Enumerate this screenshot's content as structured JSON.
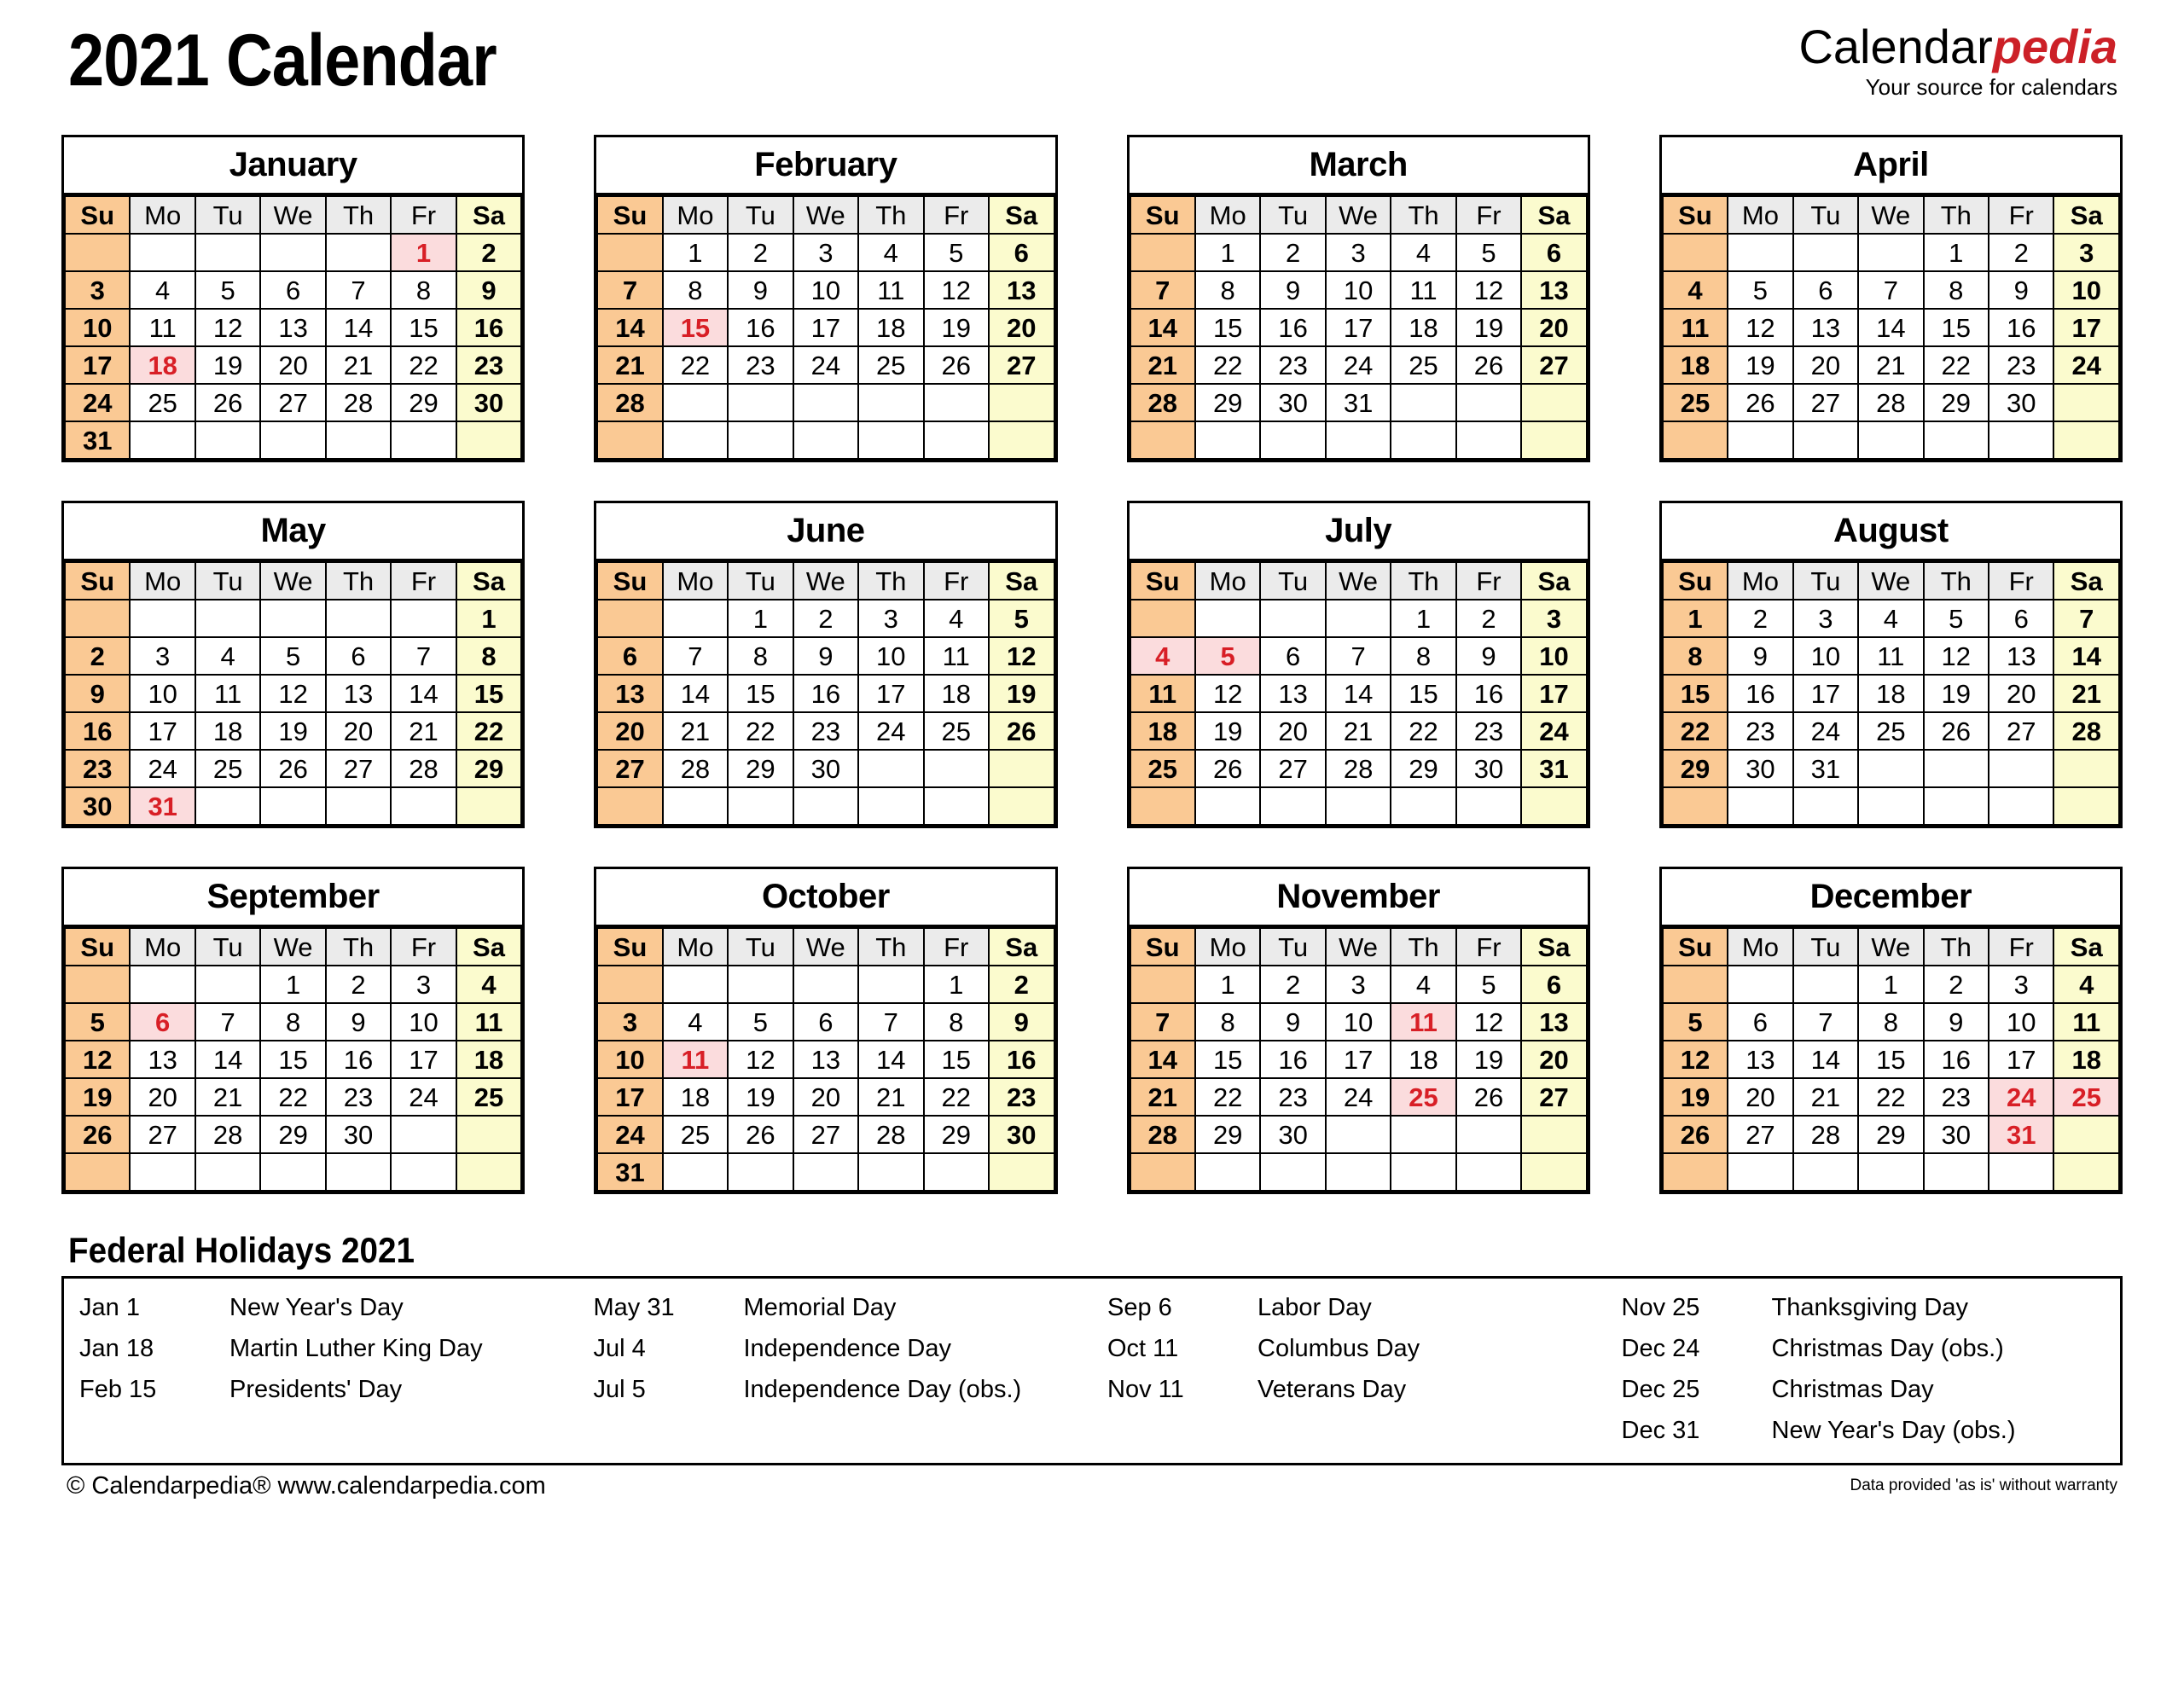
{
  "header": {
    "title": "2021 Calendar",
    "brand_word1": "Calendar",
    "brand_word2": "pedia",
    "brand_tagline": "Your source for calendars"
  },
  "colors": {
    "sunday_bg": "#FAC994",
    "saturday_bg": "#FBFBCE",
    "weekday_header_bg": "#EBEBEB",
    "holiday_bg": "#FBDCDD",
    "holiday_text": "#D81F26",
    "brand_accent": "#CC2027",
    "border": "#000000"
  },
  "weekday_headers": [
    "Su",
    "Mo",
    "Tu",
    "We",
    "Th",
    "Fr",
    "Sa"
  ],
  "months": [
    {
      "name": "January",
      "weeks": [
        [
          "",
          "",
          "",
          "",
          "",
          "1",
          "2"
        ],
        [
          "3",
          "4",
          "5",
          "6",
          "7",
          "8",
          "9"
        ],
        [
          "10",
          "11",
          "12",
          "13",
          "14",
          "15",
          "16"
        ],
        [
          "17",
          "18",
          "19",
          "20",
          "21",
          "22",
          "23"
        ],
        [
          "24",
          "25",
          "26",
          "27",
          "28",
          "29",
          "30"
        ],
        [
          "31",
          "",
          "",
          "",
          "",
          "",
          ""
        ]
      ],
      "holidays": [
        "1",
        "18"
      ]
    },
    {
      "name": "February",
      "weeks": [
        [
          "",
          "1",
          "2",
          "3",
          "4",
          "5",
          "6"
        ],
        [
          "7",
          "8",
          "9",
          "10",
          "11",
          "12",
          "13"
        ],
        [
          "14",
          "15",
          "16",
          "17",
          "18",
          "19",
          "20"
        ],
        [
          "21",
          "22",
          "23",
          "24",
          "25",
          "26",
          "27"
        ],
        [
          "28",
          "",
          "",
          "",
          "",
          "",
          ""
        ],
        [
          "",
          "",
          "",
          "",
          "",
          "",
          ""
        ]
      ],
      "holidays": [
        "15"
      ]
    },
    {
      "name": "March",
      "weeks": [
        [
          "",
          "1",
          "2",
          "3",
          "4",
          "5",
          "6"
        ],
        [
          "7",
          "8",
          "9",
          "10",
          "11",
          "12",
          "13"
        ],
        [
          "14",
          "15",
          "16",
          "17",
          "18",
          "19",
          "20"
        ],
        [
          "21",
          "22",
          "23",
          "24",
          "25",
          "26",
          "27"
        ],
        [
          "28",
          "29",
          "30",
          "31",
          "",
          "",
          ""
        ],
        [
          "",
          "",
          "",
          "",
          "",
          "",
          ""
        ]
      ],
      "holidays": []
    },
    {
      "name": "April",
      "weeks": [
        [
          "",
          "",
          "",
          "",
          "1",
          "2",
          "3"
        ],
        [
          "4",
          "5",
          "6",
          "7",
          "8",
          "9",
          "10"
        ],
        [
          "11",
          "12",
          "13",
          "14",
          "15",
          "16",
          "17"
        ],
        [
          "18",
          "19",
          "20",
          "21",
          "22",
          "23",
          "24"
        ],
        [
          "25",
          "26",
          "27",
          "28",
          "29",
          "30",
          ""
        ],
        [
          "",
          "",
          "",
          "",
          "",
          "",
          ""
        ]
      ],
      "holidays": []
    },
    {
      "name": "May",
      "weeks": [
        [
          "",
          "",
          "",
          "",
          "",
          "",
          "1"
        ],
        [
          "2",
          "3",
          "4",
          "5",
          "6",
          "7",
          "8"
        ],
        [
          "9",
          "10",
          "11",
          "12",
          "13",
          "14",
          "15"
        ],
        [
          "16",
          "17",
          "18",
          "19",
          "20",
          "21",
          "22"
        ],
        [
          "23",
          "24",
          "25",
          "26",
          "27",
          "28",
          "29"
        ],
        [
          "30",
          "31",
          "",
          "",
          "",
          "",
          ""
        ]
      ],
      "holidays": [
        "31"
      ]
    },
    {
      "name": "June",
      "weeks": [
        [
          "",
          "",
          "1",
          "2",
          "3",
          "4",
          "5"
        ],
        [
          "6",
          "7",
          "8",
          "9",
          "10",
          "11",
          "12"
        ],
        [
          "13",
          "14",
          "15",
          "16",
          "17",
          "18",
          "19"
        ],
        [
          "20",
          "21",
          "22",
          "23",
          "24",
          "25",
          "26"
        ],
        [
          "27",
          "28",
          "29",
          "30",
          "",
          "",
          ""
        ],
        [
          "",
          "",
          "",
          "",
          "",
          "",
          ""
        ]
      ],
      "holidays": []
    },
    {
      "name": "July",
      "weeks": [
        [
          "",
          "",
          "",
          "",
          "1",
          "2",
          "3"
        ],
        [
          "4",
          "5",
          "6",
          "7",
          "8",
          "9",
          "10"
        ],
        [
          "11",
          "12",
          "13",
          "14",
          "15",
          "16",
          "17"
        ],
        [
          "18",
          "19",
          "20",
          "21",
          "22",
          "23",
          "24"
        ],
        [
          "25",
          "26",
          "27",
          "28",
          "29",
          "30",
          "31"
        ],
        [
          "",
          "",
          "",
          "",
          "",
          "",
          ""
        ]
      ],
      "holidays": [
        "4",
        "5"
      ]
    },
    {
      "name": "August",
      "weeks": [
        [
          "1",
          "2",
          "3",
          "4",
          "5",
          "6",
          "7"
        ],
        [
          "8",
          "9",
          "10",
          "11",
          "12",
          "13",
          "14"
        ],
        [
          "15",
          "16",
          "17",
          "18",
          "19",
          "20",
          "21"
        ],
        [
          "22",
          "23",
          "24",
          "25",
          "26",
          "27",
          "28"
        ],
        [
          "29",
          "30",
          "31",
          "",
          "",
          "",
          ""
        ],
        [
          "",
          "",
          "",
          "",
          "",
          "",
          ""
        ]
      ],
      "holidays": []
    },
    {
      "name": "September",
      "weeks": [
        [
          "",
          "",
          "",
          "1",
          "2",
          "3",
          "4"
        ],
        [
          "5",
          "6",
          "7",
          "8",
          "9",
          "10",
          "11"
        ],
        [
          "12",
          "13",
          "14",
          "15",
          "16",
          "17",
          "18"
        ],
        [
          "19",
          "20",
          "21",
          "22",
          "23",
          "24",
          "25"
        ],
        [
          "26",
          "27",
          "28",
          "29",
          "30",
          "",
          ""
        ],
        [
          "",
          "",
          "",
          "",
          "",
          "",
          ""
        ]
      ],
      "holidays": [
        "6"
      ]
    },
    {
      "name": "October",
      "weeks": [
        [
          "",
          "",
          "",
          "",
          "",
          "1",
          "2"
        ],
        [
          "3",
          "4",
          "5",
          "6",
          "7",
          "8",
          "9"
        ],
        [
          "10",
          "11",
          "12",
          "13",
          "14",
          "15",
          "16"
        ],
        [
          "17",
          "18",
          "19",
          "20",
          "21",
          "22",
          "23"
        ],
        [
          "24",
          "25",
          "26",
          "27",
          "28",
          "29",
          "30"
        ],
        [
          "31",
          "",
          "",
          "",
          "",
          "",
          ""
        ]
      ],
      "holidays": [
        "11"
      ]
    },
    {
      "name": "November",
      "weeks": [
        [
          "",
          "1",
          "2",
          "3",
          "4",
          "5",
          "6"
        ],
        [
          "7",
          "8",
          "9",
          "10",
          "11",
          "12",
          "13"
        ],
        [
          "14",
          "15",
          "16",
          "17",
          "18",
          "19",
          "20"
        ],
        [
          "21",
          "22",
          "23",
          "24",
          "25",
          "26",
          "27"
        ],
        [
          "28",
          "29",
          "30",
          "",
          "",
          "",
          ""
        ],
        [
          "",
          "",
          "",
          "",
          "",
          "",
          ""
        ]
      ],
      "holidays": [
        "11",
        "25"
      ]
    },
    {
      "name": "December",
      "weeks": [
        [
          "",
          "",
          "",
          "1",
          "2",
          "3",
          "4"
        ],
        [
          "5",
          "6",
          "7",
          "8",
          "9",
          "10",
          "11"
        ],
        [
          "12",
          "13",
          "14",
          "15",
          "16",
          "17",
          "18"
        ],
        [
          "19",
          "20",
          "21",
          "22",
          "23",
          "24",
          "25"
        ],
        [
          "26",
          "27",
          "28",
          "29",
          "30",
          "31",
          ""
        ],
        [
          "",
          "",
          "",
          "",
          "",
          "",
          ""
        ]
      ],
      "holidays": [
        "24",
        "25",
        "31"
      ]
    }
  ],
  "holidays_section": {
    "heading": "Federal Holidays 2021",
    "columns": [
      [
        {
          "date": "Jan 1",
          "name": "New Year's Day"
        },
        {
          "date": "Jan 18",
          "name": "Martin Luther King Day"
        },
        {
          "date": "Feb 15",
          "name": "Presidents' Day"
        }
      ],
      [
        {
          "date": "May 31",
          "name": "Memorial Day"
        },
        {
          "date": "Jul 4",
          "name": "Independence Day"
        },
        {
          "date": "Jul 5",
          "name": "Independence Day (obs.)"
        }
      ],
      [
        {
          "date": "Sep 6",
          "name": "Labor Day"
        },
        {
          "date": "Oct 11",
          "name": "Columbus Day"
        },
        {
          "date": "Nov 11",
          "name": "Veterans Day"
        }
      ],
      [
        {
          "date": "Nov 25",
          "name": "Thanksgiving Day"
        },
        {
          "date": "Dec 24",
          "name": "Christmas Day (obs.)"
        },
        {
          "date": "Dec 25",
          "name": "Christmas Day"
        },
        {
          "date": "Dec 31",
          "name": "New Year's Day (obs.)"
        }
      ]
    ]
  },
  "footer": {
    "copyright": "© Calendarpedia®   www.calendarpedia.com",
    "disclaimer": "Data provided 'as is' without warranty"
  }
}
